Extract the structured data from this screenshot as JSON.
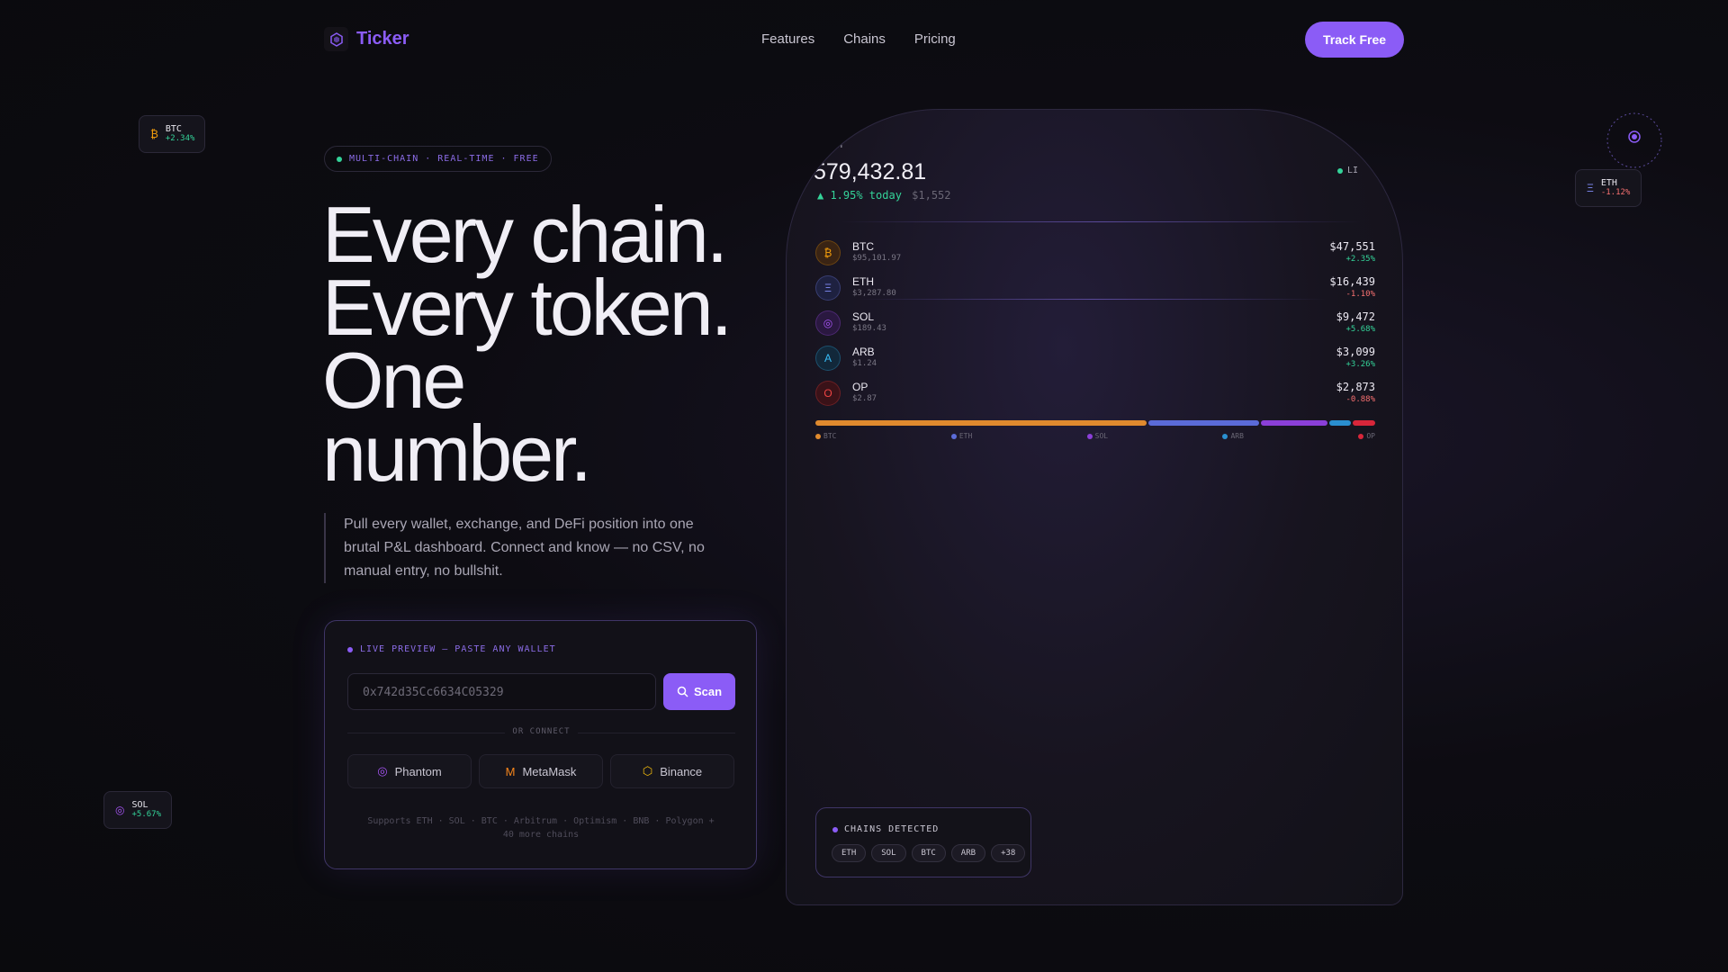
{
  "nav": {
    "brand": "Ticker",
    "links": [
      "Features",
      "Chains",
      "Pricing"
    ],
    "cta": "Track Free"
  },
  "float_chips": [
    {
      "symbol": "₿",
      "name": "BTC",
      "change": "+2.34%",
      "color": "#f59e0b",
      "change_color": "#34d399"
    },
    {
      "symbol": "Ξ",
      "name": "ETH",
      "change": "-1.12%",
      "color": "#818cf8",
      "change_color": "#f87171"
    },
    {
      "symbol": "◎",
      "name": "SOL",
      "change": "+5.67%",
      "color": "#a855f7",
      "change_color": "#34d399"
    }
  ],
  "badge": "MULTI-CHAIN · REAL-TIME · FREE",
  "headline": [
    "Every chain.",
    "Every token.",
    "One",
    "number."
  ],
  "subtext": "Pull every wallet, exchange, and DeFi position into one brutal P&L dashboard. Connect and know — no CSV, no manual entry, no bullshit.",
  "preview": {
    "label": "LIVE PREVIEW — PASTE ANY WALLET",
    "input_value": "0x742d35Cc6634C05329",
    "scan": "Scan",
    "or_connect": "OR CONNECT",
    "wallets": [
      {
        "icon": "◎",
        "label": "Phantom",
        "color": "#a855f7"
      },
      {
        "icon": "M",
        "label": "MetaMask",
        "color": "#f6851b"
      },
      {
        "icon": "⬡",
        "label": "Binance",
        "color": "#f0b90b"
      }
    ],
    "supports": "Supports ETH · SOL · BTC · Arbitrum · Optimism · BNB · Polygon + 40 more chains"
  },
  "dashboard": {
    "net_worth_label": "RTH",
    "net_worth": "579,432.81",
    "change_pct": "▲ 1.95% today",
    "change_abs": "$1,552",
    "live_label": "LI",
    "holdings": [
      {
        "symbol": "₿",
        "name": "BTC",
        "price": "$95,101.97",
        "value": "$47,551",
        "change": "+2.35%",
        "color": "#f59e0b",
        "bg": "#3a2414",
        "up": true
      },
      {
        "symbol": "Ξ",
        "name": "ETH",
        "price": "$3,287.80",
        "value": "$16,439",
        "change": "-1.10%",
        "color": "#818cf8",
        "bg": "#1e2140",
        "up": false
      },
      {
        "symbol": "◎",
        "name": "SOL",
        "price": "$189.43",
        "value": "$9,472",
        "change": "+5.68%",
        "color": "#a855f7",
        "bg": "#2a1840",
        "up": true
      },
      {
        "symbol": "A",
        "name": "ARB",
        "price": "$1.24",
        "value": "$3,099",
        "change": "+3.26%",
        "color": "#38bdf8",
        "bg": "#12283a",
        "up": true
      },
      {
        "symbol": "O",
        "name": "OP",
        "price": "$2.87",
        "value": "$2,873",
        "change": "-0.88%",
        "color": "#ef4444",
        "bg": "#3a1218",
        "up": false
      }
    ],
    "allocation": [
      {
        "name": "BTC",
        "share": 0.6,
        "color": "#e08a2e"
      },
      {
        "name": "ETH",
        "share": 0.2,
        "color": "#5b6bd8"
      },
      {
        "name": "SOL",
        "share": 0.12,
        "color": "#8b3fd8"
      },
      {
        "name": "ARB",
        "share": 0.04,
        "color": "#2a8fd0"
      },
      {
        "name": "OP",
        "share": 0.04,
        "color": "#d8263a"
      }
    ],
    "chains_label": "CHAINS DETECTED",
    "chains": [
      "ETH",
      "SOL",
      "BTC",
      "ARB",
      "+38"
    ]
  },
  "colors": {
    "accent": "#8b5cf6",
    "up": "#34d399",
    "down": "#f87171"
  }
}
